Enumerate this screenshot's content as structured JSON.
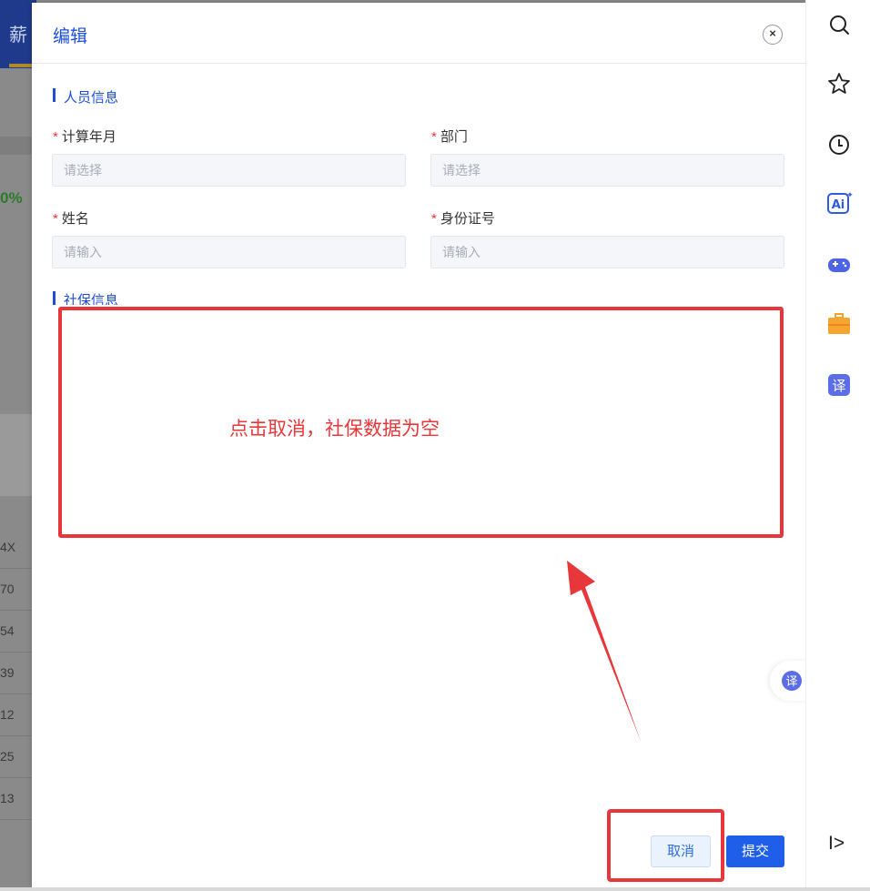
{
  "background": {
    "header_text": "薪",
    "percent_text": "0%",
    "cells": [
      "4X",
      "70",
      "54",
      "39",
      "12",
      "25",
      "13"
    ]
  },
  "modal": {
    "title": "编辑",
    "close_icon": "close-icon",
    "section_personal": "人员信息",
    "section_social": "社保信息",
    "fields": {
      "calc_month": {
        "label": "计算年月",
        "placeholder": "请选择"
      },
      "department": {
        "label": "部门",
        "placeholder": "请选择"
      },
      "name": {
        "label": "姓名",
        "placeholder": "请输入"
      },
      "id_number": {
        "label": "身份证号",
        "placeholder": "请输入"
      }
    },
    "required_mark": "*",
    "cancel_label": "取消",
    "submit_label": "提交"
  },
  "annotation": {
    "text": "点击取消，社保数据为空",
    "color": "#e8373a"
  },
  "sidebar": {
    "icons": [
      "search-icon",
      "star-icon",
      "history-icon",
      "ai-icon",
      "game-icon",
      "briefcase-icon",
      "translate-icon",
      "collapse-icon"
    ],
    "ai_text": "Ai",
    "translate_text": "译",
    "collapse_text": "I>"
  },
  "colors": {
    "primary": "#1d4ed8",
    "submit": "#1f5ee8",
    "required": "#e53935",
    "annotation": "#e8373a"
  }
}
